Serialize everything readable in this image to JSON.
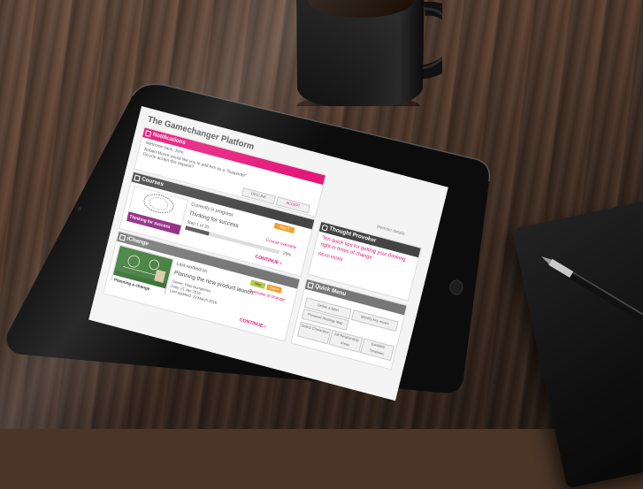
{
  "platform": {
    "title": "The Gamechanger Platform",
    "member_link": "Member details"
  },
  "notifications": {
    "header": "Notifications",
    "line1": "Welcome back, John",
    "line2": "Robert Moore would like you to add him as a \"Supporter\"",
    "line3": "Do you accept this request?",
    "decline": "DECLINE",
    "accept": "ACCEPT"
  },
  "courses": {
    "header": "Courses",
    "thumb_label": "Thinking for success",
    "status": "Currently in progress",
    "badge": "Step 1",
    "course_title": "Thinking for success",
    "step": "Step 1 of 20",
    "overview_link": "Course overview",
    "progress_pct": "25%",
    "progress_value": 0.25,
    "continue": "CONTINUE"
  },
  "ichange": {
    "header": "iChange",
    "thumb_label": "Planning a change",
    "last_worked": "Last worked on",
    "badge1": "Step",
    "badge2": "Day 4",
    "plan_title": "Planning the new product launch.",
    "detail1": "Owner: Paul Humphries",
    "detail2": "Date: 21 Jan 2016",
    "detail3": "Last updated: 23 March 2016",
    "overview_link": "Overview of change",
    "continue": "CONTINUE"
  },
  "thought": {
    "header": "Thought Provoker",
    "text": "Ten quick tips for getting your thinking right in times of change",
    "read_more": "READ MORE"
  },
  "quick_menu": {
    "header": "Quick Menu",
    "items": [
      "Define a label",
      "Identify key issues",
      "Personal Strategy Map",
      "Select Characters",
      "Fill Relationship Areas",
      "Establish Timelines"
    ]
  },
  "colors": {
    "accent": "#e5177a",
    "dark_bar": "#444444"
  }
}
